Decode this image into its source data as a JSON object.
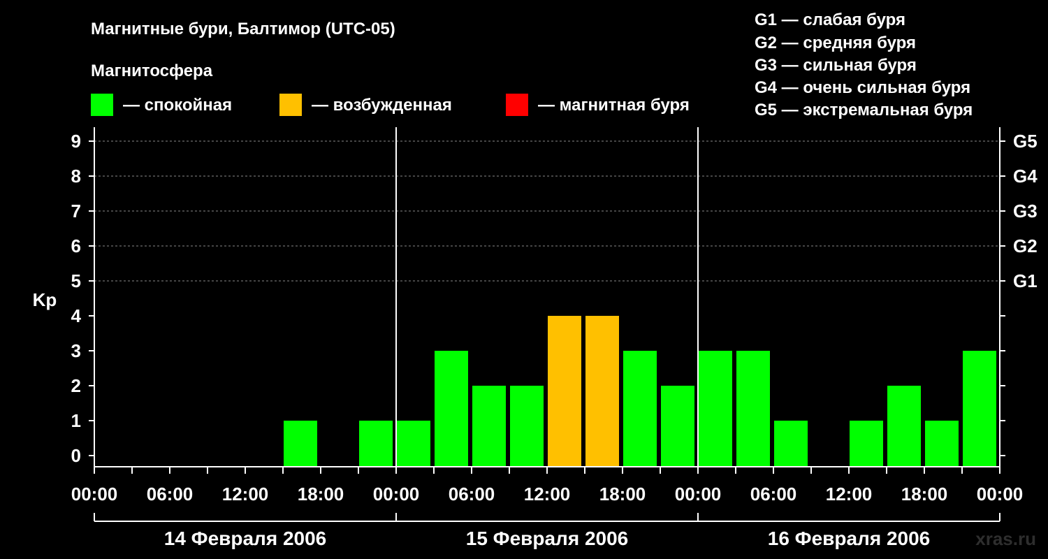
{
  "chart_data": {
    "type": "bar",
    "title": "Магнитные бури, Балтимор (UTC-05)",
    "ylabel": "Kp",
    "ylim": [
      0,
      9
    ],
    "yticks": [
      "0",
      "1",
      "2",
      "3",
      "4",
      "5",
      "6",
      "7",
      "8",
      "9"
    ],
    "storm_levels": [
      {
        "kp": 5,
        "label": "G1"
      },
      {
        "kp": 6,
        "label": "G2"
      },
      {
        "kp": 7,
        "label": "G3"
      },
      {
        "kp": 8,
        "label": "G4"
      },
      {
        "kp": 9,
        "label": "G5"
      }
    ],
    "storm_legend": [
      "G1 — слабая буря",
      "G2 — средняя буря",
      "G3 — сильная буря",
      "G4 — очень сильная буря",
      "G5 — экстремальная буря"
    ],
    "legend_title": "Магнитосфера",
    "legend": [
      {
        "label": "— спокойная",
        "color": "#00ff00"
      },
      {
        "label": "— возбужденная",
        "color": "#ffc000"
      },
      {
        "label": "— магнитная буря",
        "color": "#ff0000"
      }
    ],
    "x_tick_labels": [
      "00:00",
      "06:00",
      "12:00",
      "18:00",
      "00:00",
      "06:00",
      "12:00",
      "18:00",
      "00:00",
      "06:00",
      "12:00",
      "18:00",
      "00:00"
    ],
    "days": [
      "14 Февраля 2006",
      "15 Февраля 2006",
      "16 Февраля 2006"
    ],
    "bar_interval_hours": 3,
    "values": [
      0,
      0,
      0,
      0,
      0,
      1,
      0,
      1,
      1,
      3,
      2,
      2,
      4,
      4,
      3,
      2,
      3,
      3,
      1,
      0,
      1,
      2,
      1,
      3
    ],
    "colors": {
      "quiet": "#00ff00",
      "active": "#ffc000",
      "storm": "#ff0000"
    },
    "watermark": "xras.ru",
    "grid": true
  }
}
